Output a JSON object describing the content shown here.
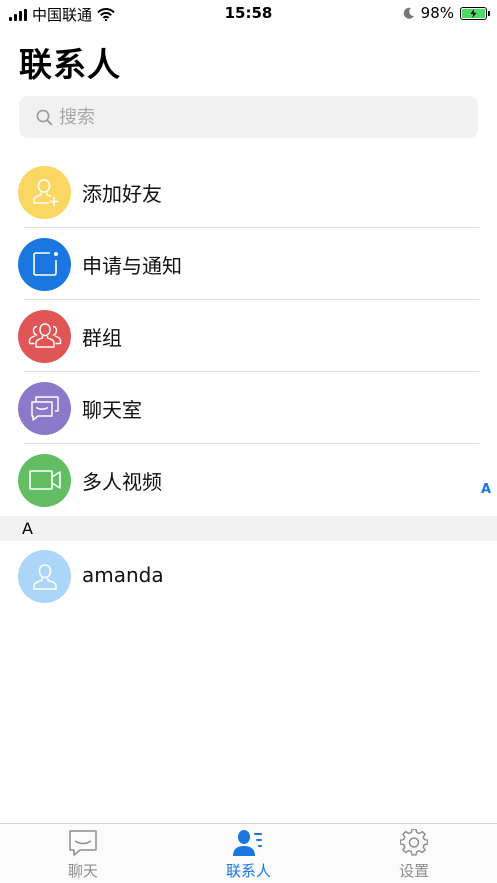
{
  "status_bar": {
    "carrier": "中国联通",
    "time": "15:58",
    "battery_percent": "98%",
    "battery_level": 0.98
  },
  "header": {
    "title": "联系人"
  },
  "search": {
    "placeholder": "搜索"
  },
  "menu_items": [
    {
      "label": "添加好友",
      "color": "#f9d762",
      "icon": "add-user-icon"
    },
    {
      "label": "申请与通知",
      "color": "#1a77e1",
      "icon": "notification-icon"
    },
    {
      "label": "群组",
      "color": "#e05656",
      "icon": "group-icon"
    },
    {
      "label": "聊天室",
      "color": "#8b79c9",
      "icon": "chatroom-icon"
    },
    {
      "label": "多人视频",
      "color": "#62bd63",
      "icon": "video-icon"
    }
  ],
  "section": {
    "letter": "A"
  },
  "contacts": [
    {
      "name": "amanda",
      "color": "#abd6f8",
      "icon": "person-icon"
    }
  ],
  "index_bar": {
    "letters": [
      "A"
    ]
  },
  "tab_bar": {
    "tabs": [
      {
        "label": "聊天",
        "icon": "chat-icon",
        "active": false
      },
      {
        "label": "联系人",
        "icon": "contacts-icon",
        "active": true
      },
      {
        "label": "设置",
        "icon": "gear-icon",
        "active": false
      }
    ],
    "active_color": "#1a77e1",
    "inactive_color": "#8e8e8e"
  }
}
